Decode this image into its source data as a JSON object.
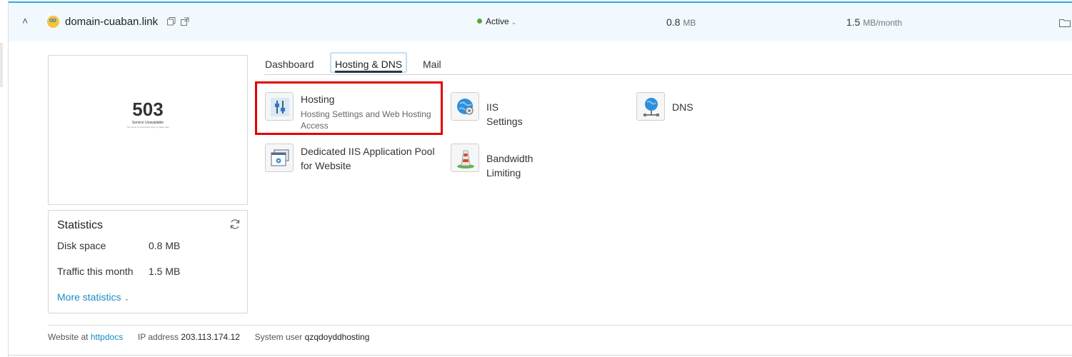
{
  "header": {
    "domain": "domain-cuaban.link",
    "status": "Active",
    "disk_value": "0.8",
    "disk_unit": "MB",
    "traffic_value": "1.5",
    "traffic_unit": "MB/month"
  },
  "preview": {
    "code": "503",
    "message": "Service Unavailable",
    "sub": "The server is temporarily busy, try again later"
  },
  "stats": {
    "title": "Statistics",
    "rows": [
      {
        "label": "Disk space",
        "value": "0.8 MB"
      },
      {
        "label": "Traffic this month",
        "value": "1.5 MB"
      }
    ],
    "more": "More statistics"
  },
  "tabs": [
    "Dashboard",
    "Hosting & DNS",
    "Mail"
  ],
  "tools": [
    {
      "name": "Hosting",
      "desc": "Hosting Settings and Web Hosting Access",
      "icon": "sliders-icon"
    },
    {
      "name": "IIS Settings",
      "icon": "globe-gear-icon"
    },
    {
      "name": "DNS",
      "icon": "globe-network-icon"
    },
    {
      "name": "Dedicated IIS Application Pool for Website",
      "icon": "app-pool-icon"
    },
    {
      "name": "Bandwidth Limiting",
      "icon": "traffic-cone-icon"
    }
  ],
  "footer": {
    "website_label": "Website at",
    "website_link": "httpdocs",
    "ip_label": "IP address",
    "ip_value": "203.113.174.12",
    "user_label": "System user",
    "user_value": "qzqdoyddhosting"
  },
  "colors": {
    "accent": "#28aade",
    "header_bg": "#f1f9fe",
    "active_dot": "#52a832",
    "link": "#1a8bc4",
    "highlight": "#e30000"
  }
}
